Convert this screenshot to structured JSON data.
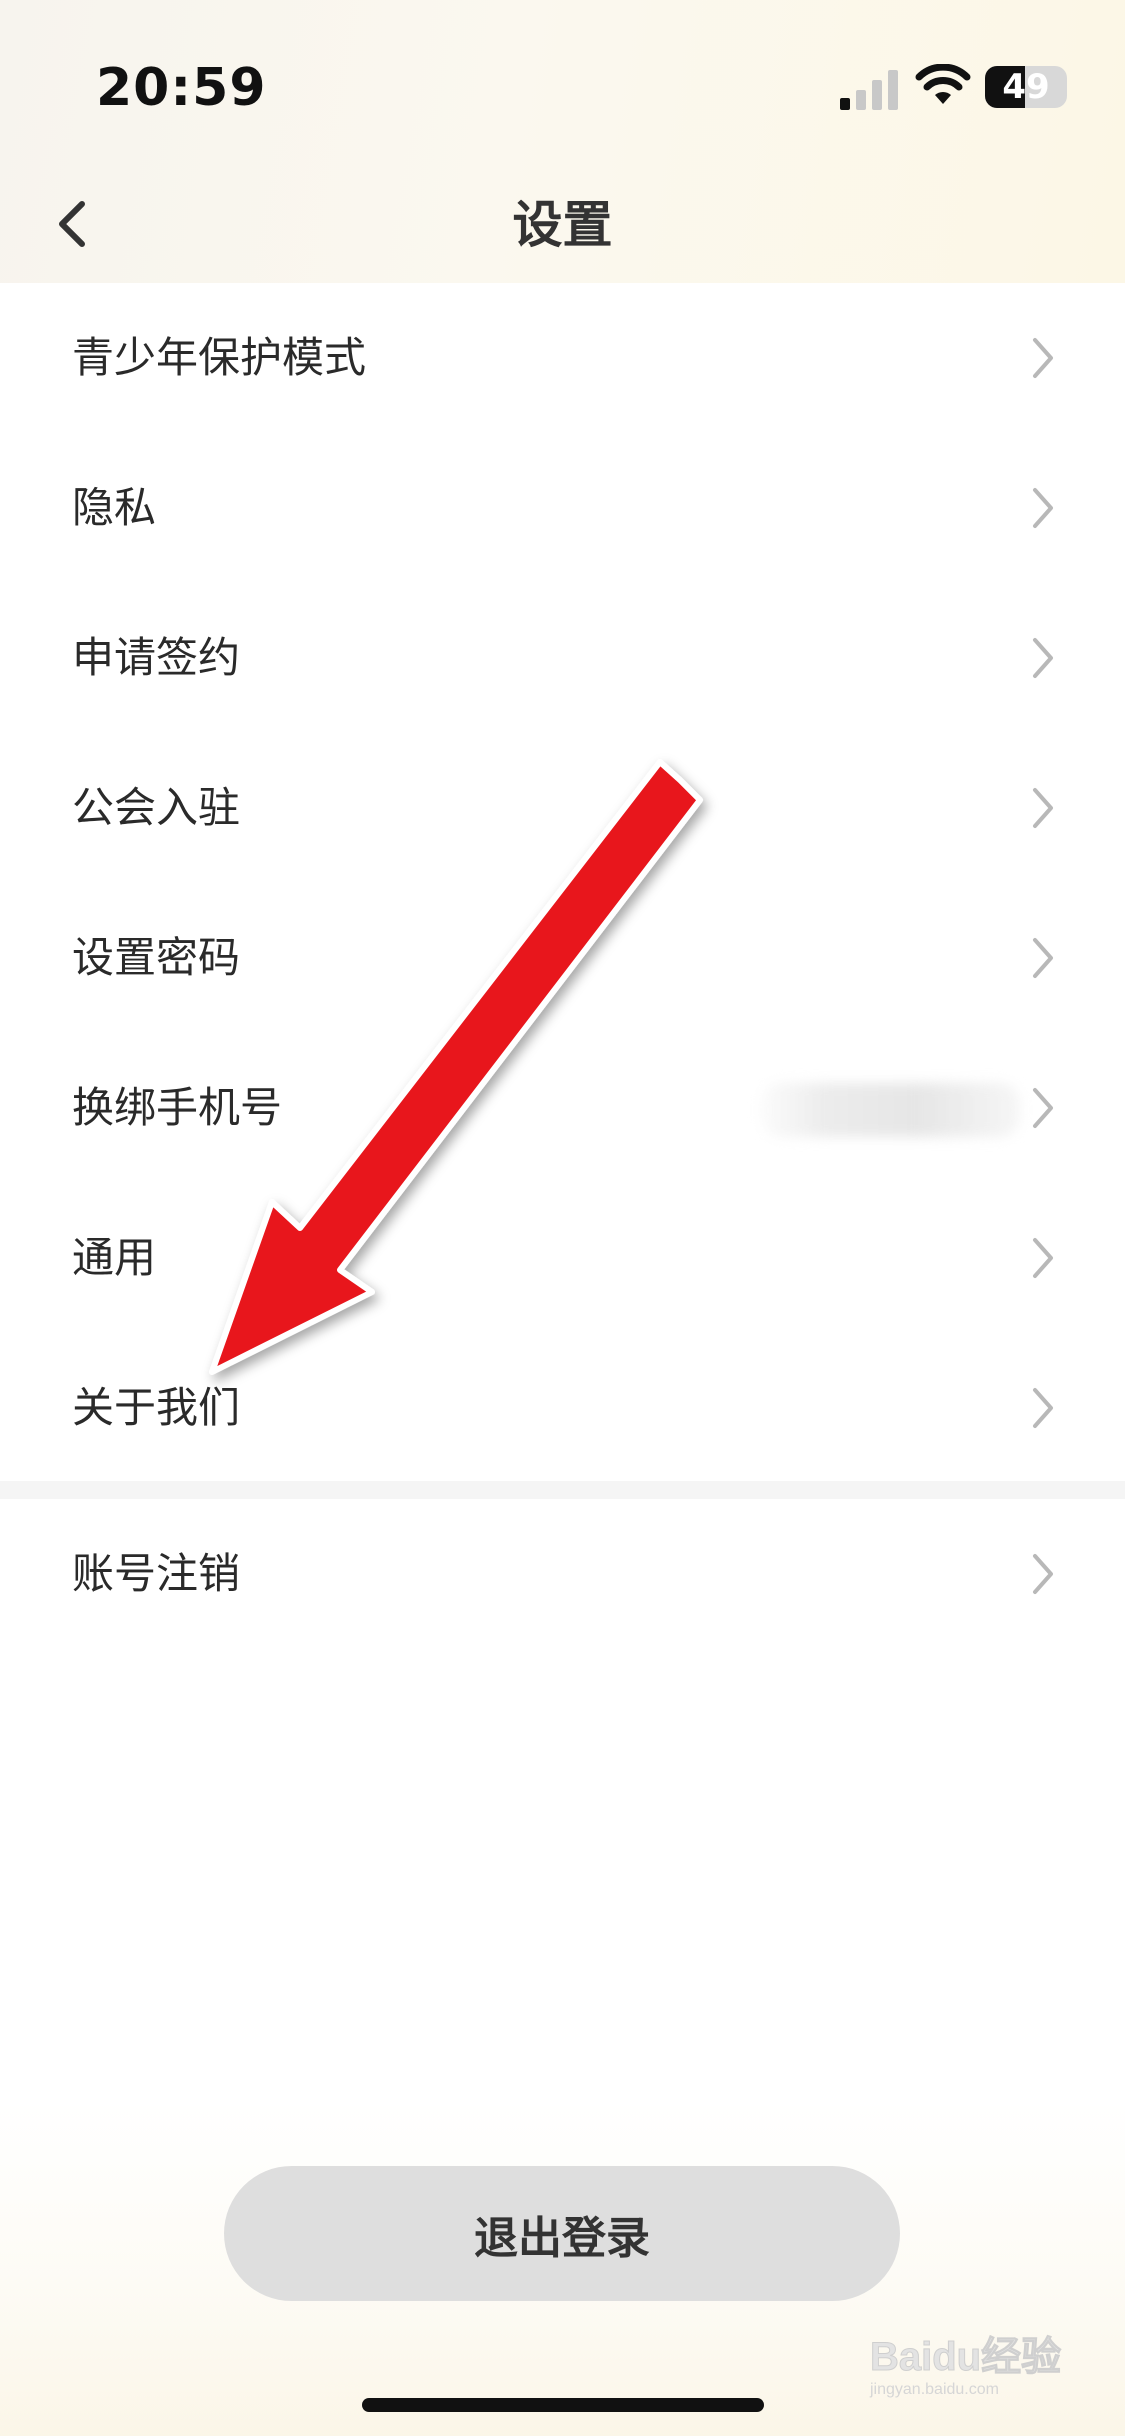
{
  "status_bar": {
    "time": "20:59",
    "battery_level": "49",
    "battery_fraction": 0.49
  },
  "nav": {
    "title": "设置"
  },
  "settings_items": [
    {
      "label": "青少年保护模式"
    },
    {
      "label": "隐私"
    },
    {
      "label": "申请签约"
    },
    {
      "label": "公会入驻"
    },
    {
      "label": "设置密码"
    },
    {
      "label": "换绑手机号"
    },
    {
      "label": "通用"
    },
    {
      "label": "关于我们"
    }
  ],
  "secondary_items": [
    {
      "label": "账号注销"
    }
  ],
  "logout": {
    "label": "退出登录"
  },
  "watermark": {
    "brand": "Baidu经验",
    "site": "jingyan.baidu.com"
  },
  "colors": {
    "annotation_arrow": "#e8141b",
    "logout_bg": "#dedede",
    "chevron": "#b8b8b8"
  },
  "icons": {
    "back": "chevron-left-icon",
    "row": "chevron-right-icon",
    "signal": "cellular-signal-icon",
    "wifi": "wifi-icon",
    "battery": "battery-icon"
  }
}
